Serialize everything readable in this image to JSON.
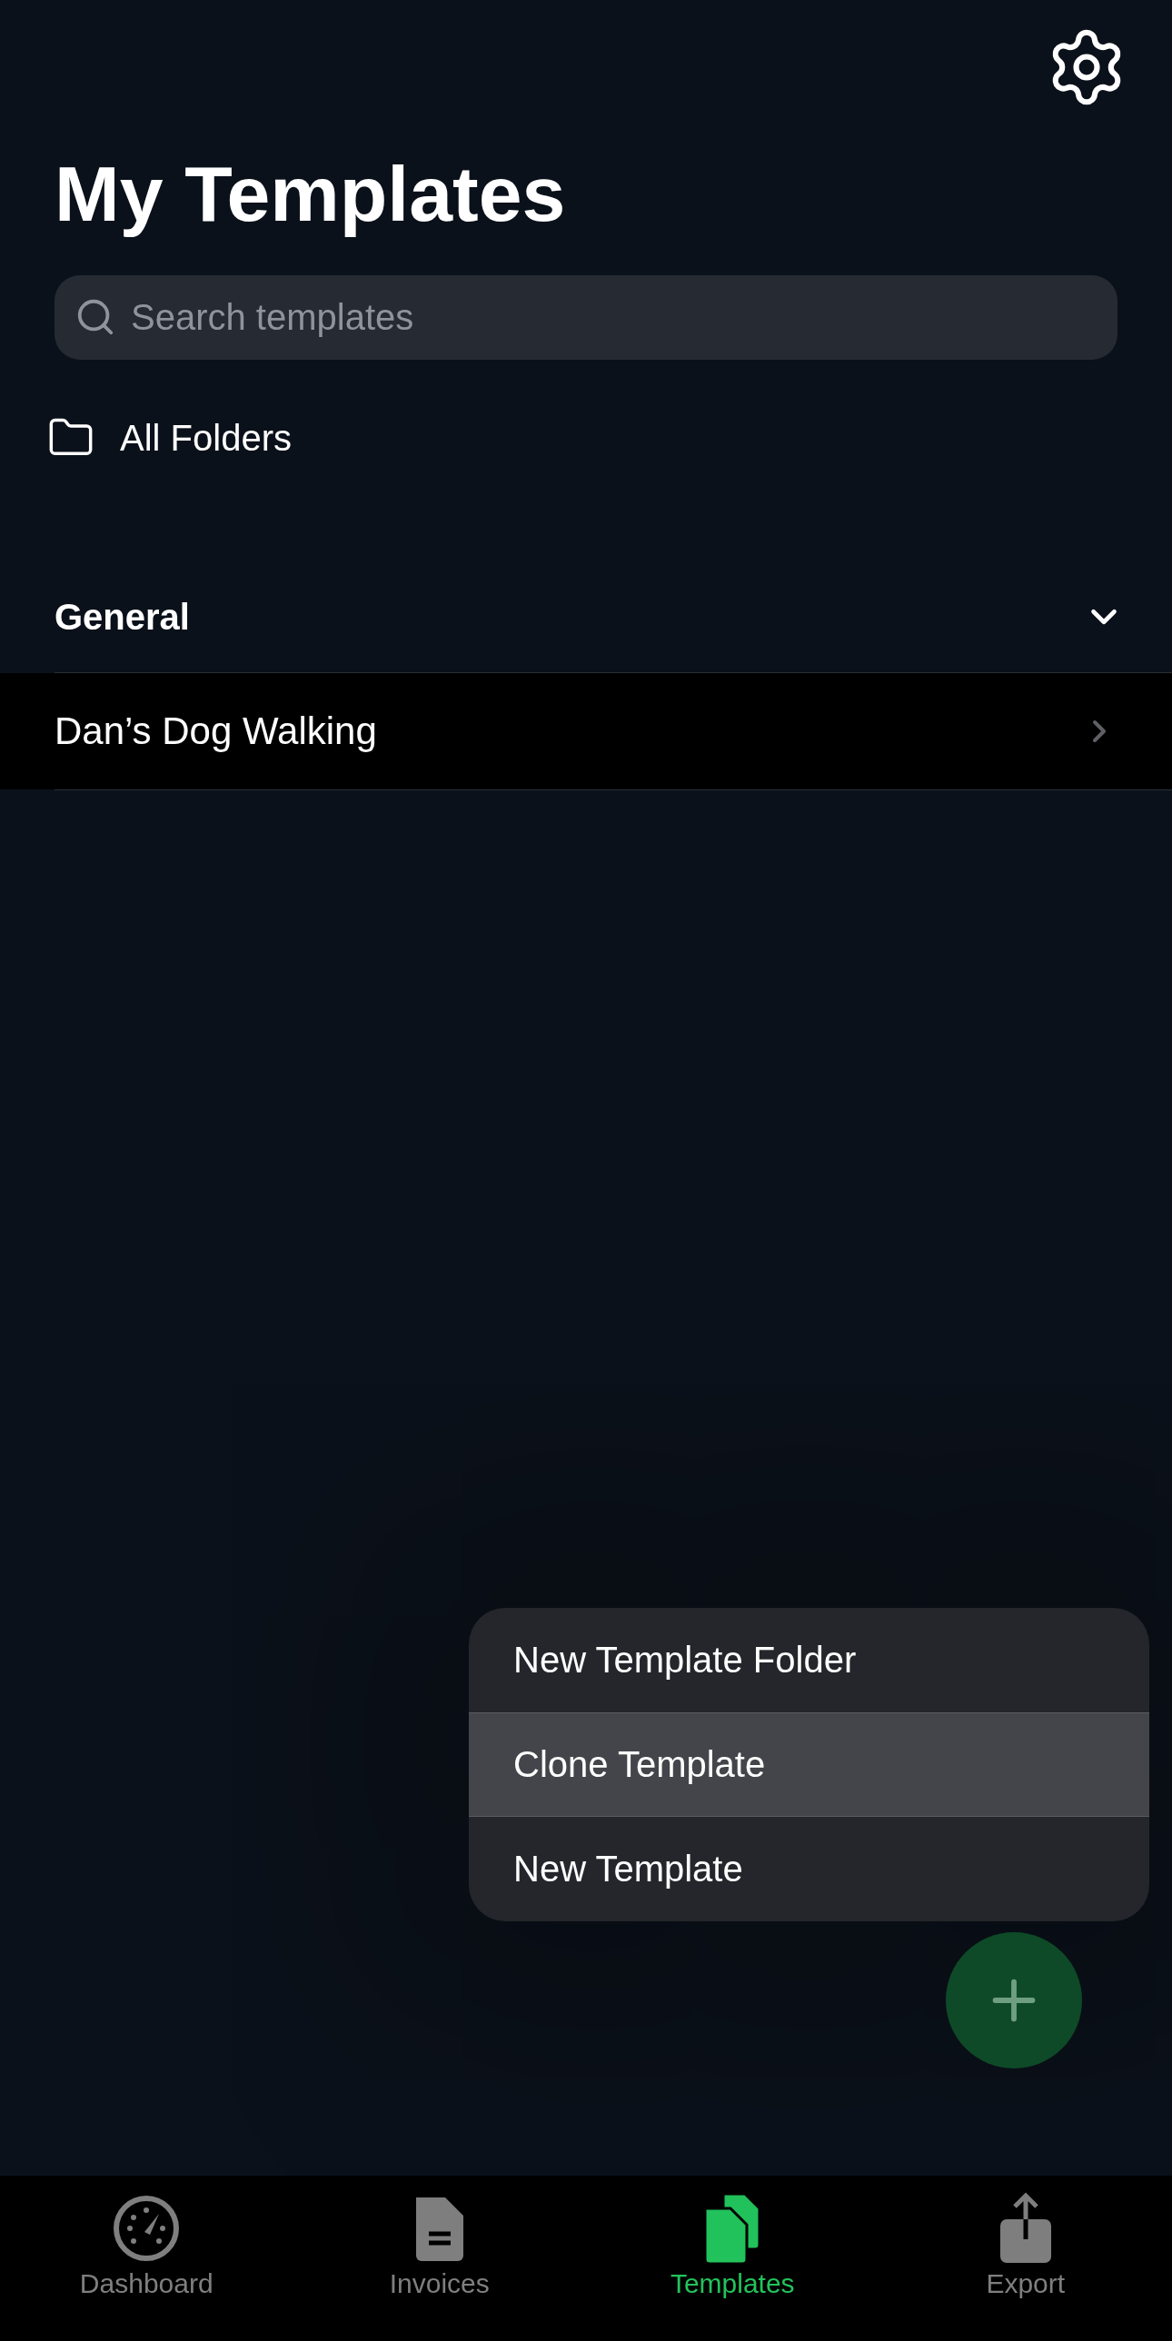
{
  "title": "My Templates",
  "search": {
    "placeholder": "Search templates"
  },
  "folder_filter": {
    "label": "All Folders"
  },
  "groups": [
    {
      "title": "General",
      "expanded": true,
      "items": [
        {
          "label": "Dan’s Dog Walking"
        }
      ]
    }
  ],
  "menu": [
    {
      "label": "New Template Folder",
      "selected": false
    },
    {
      "label": "Clone Template",
      "selected": true
    },
    {
      "label": "New Template",
      "selected": false
    }
  ],
  "tabs": [
    {
      "label": "Dashboard",
      "kind": "dashboard",
      "selected": false
    },
    {
      "label": "Invoices",
      "kind": "invoices",
      "selected": false
    },
    {
      "label": "Templates",
      "kind": "templates",
      "selected": true
    },
    {
      "label": "Export",
      "kind": "export",
      "selected": false
    }
  ]
}
